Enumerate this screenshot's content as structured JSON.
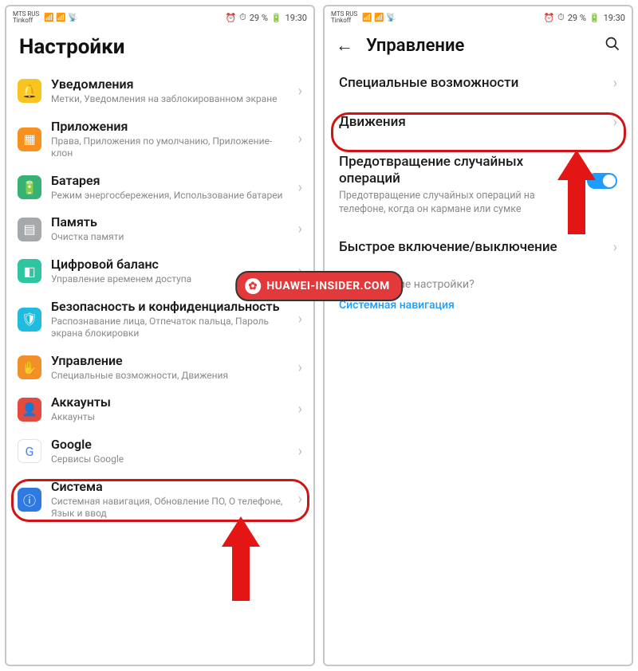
{
  "status": {
    "carrier1": "МТS RUS",
    "carrier2": "Tinkoff",
    "battery": "29 %",
    "time": "19:30"
  },
  "left": {
    "header": "Настройки",
    "rows": [
      {
        "icon": "bell-icon",
        "iconClass": "c-yellow",
        "title": "Уведомления",
        "sub": "Метки, Уведомления на заблокированном экране"
      },
      {
        "icon": "apps-icon",
        "iconClass": "c-orange",
        "title": "Приложения",
        "sub": "Права, Приложения по умолчанию, Приложение-клон"
      },
      {
        "icon": "battery-icon",
        "iconClass": "c-green",
        "title": "Батарея",
        "sub": "Режим энергосбережения, Использование батареи"
      },
      {
        "icon": "memory-icon",
        "iconClass": "c-gray",
        "title": "Память",
        "sub": "Очистка памяти"
      },
      {
        "icon": "balance-icon",
        "iconClass": "c-teal",
        "title": "Цифровой баланс",
        "sub": "Управление временем доступа"
      },
      {
        "icon": "shield-icon",
        "iconClass": "c-cyan",
        "title": "Безопасность и конфиденциальность",
        "sub": "Распознавание лица, Отпечаток пальца, Пароль экрана блокировки"
      },
      {
        "icon": "hand-icon",
        "iconClass": "c-orange2",
        "title": "Управление",
        "sub": "Специальные возможности, Движения"
      },
      {
        "icon": "user-icon",
        "iconClass": "c-red",
        "title": "Аккаунты",
        "sub": "Аккаунты"
      },
      {
        "icon": "google-icon",
        "iconClass": "c-white",
        "title": "Google",
        "sub": "Сервисы Google"
      },
      {
        "icon": "system-icon",
        "iconClass": "c-blue",
        "title": "Система",
        "sub": "Системная навигация, Обновление ПО, О телефоне, Язык и ввод"
      }
    ]
  },
  "right": {
    "header": "Управление",
    "rows": [
      {
        "title": "Специальные возможности",
        "type": "nav"
      },
      {
        "title": "Движения",
        "type": "nav",
        "highlighted": true
      },
      {
        "title": "Предотвращение случайных операций",
        "sub": "Предотвращение случайных операций на телефоне, когда он кармане или сумке",
        "type": "toggle"
      },
      {
        "title": "Быстрое включение/выключение",
        "type": "nav"
      }
    ],
    "footer_q": "Ищете другие настройки?",
    "footer_link": "Системная навигация"
  },
  "watermark": "HUAWEI-INSIDER.COM"
}
